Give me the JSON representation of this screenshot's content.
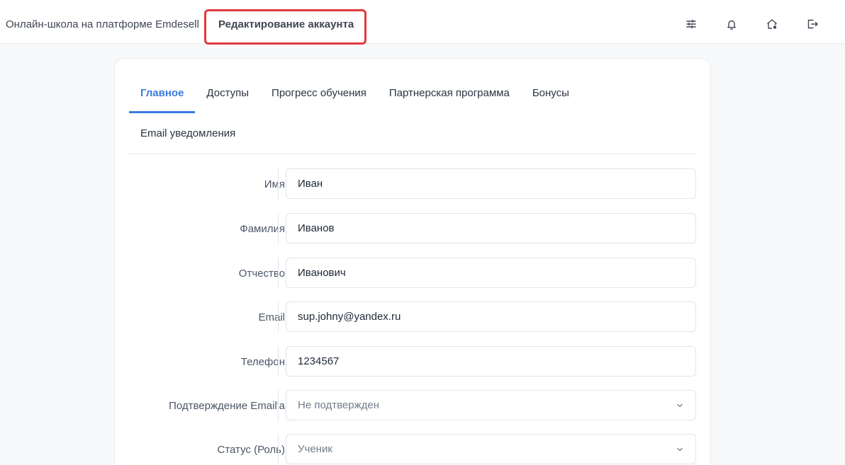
{
  "header": {
    "brand": "Онлайн-школа на платформе Emdesell",
    "page_title": "Редактирование аккаунта",
    "icons": [
      "sliders-icon",
      "bell-icon",
      "home-settings-icon",
      "logout-icon"
    ]
  },
  "tabs": [
    {
      "label": "Главное",
      "active": true
    },
    {
      "label": "Доступы",
      "active": false
    },
    {
      "label": "Прогресс обучения",
      "active": false
    },
    {
      "label": "Партнерская программа",
      "active": false
    },
    {
      "label": "Бонусы",
      "active": false
    },
    {
      "label": "Email уведомления",
      "active": false
    }
  ],
  "form": {
    "first_name": {
      "label": "Имя",
      "value": "Иван"
    },
    "last_name": {
      "label": "Фамилия",
      "value": "Иванов"
    },
    "middle_name": {
      "label": "Отчество",
      "value": "Иванович"
    },
    "email": {
      "label": "Email",
      "value": "sup.johny@yandex.ru"
    },
    "phone": {
      "label": "Телефон",
      "value": "1234567"
    },
    "email_confirmation": {
      "label": "Подтверждение Email'а",
      "value": "Не подтвержден"
    },
    "status_role": {
      "label": "Статус (Роль)",
      "value": "Ученик"
    }
  },
  "colors": {
    "accent": "#3b7be0",
    "highlight_box": "#e0393e",
    "background": "#f8f9fb"
  }
}
